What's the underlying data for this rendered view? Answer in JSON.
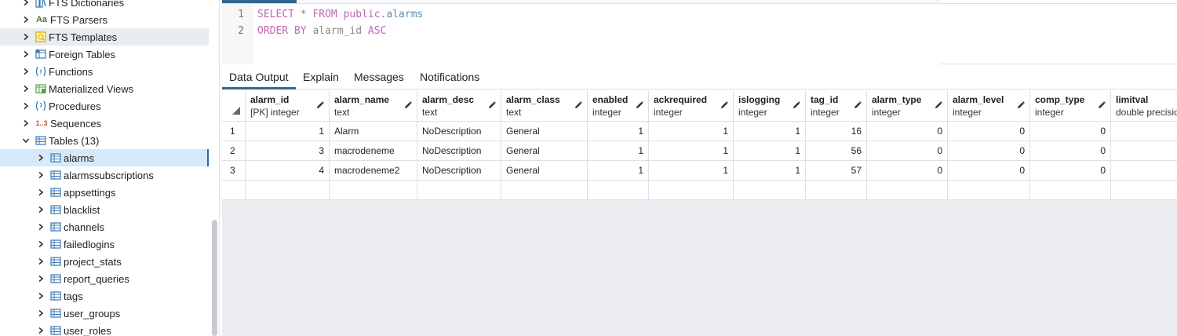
{
  "sidebar": {
    "items": [
      {
        "label": "FTS Dictionaries",
        "icon": "fts-dictionaries-icon",
        "level": 1,
        "state": "collapsed"
      },
      {
        "label": "FTS Parsers",
        "icon": "fts-parsers-icon",
        "glyph": "Aa",
        "level": 1,
        "state": "collapsed"
      },
      {
        "label": "FTS Templates",
        "icon": "fts-templates-icon",
        "level": 1,
        "state": "collapsed",
        "hover": true
      },
      {
        "label": "Foreign Tables",
        "icon": "foreign-tables-icon",
        "level": 1,
        "state": "collapsed"
      },
      {
        "label": "Functions",
        "icon": "functions-icon",
        "level": 1,
        "state": "collapsed"
      },
      {
        "label": "Materialized Views",
        "icon": "materialized-views-icon",
        "level": 1,
        "state": "collapsed"
      },
      {
        "label": "Procedures",
        "icon": "procedures-icon",
        "level": 1,
        "state": "collapsed"
      },
      {
        "label": "Sequences",
        "icon": "sequences-icon",
        "glyph": "1..3",
        "level": 1,
        "state": "collapsed"
      },
      {
        "label": "Tables (13)",
        "icon": "tables-icon",
        "level": 1,
        "state": "expanded"
      },
      {
        "label": "alarms",
        "icon": "table-icon",
        "level": 2,
        "state": "collapsed",
        "selected": true
      },
      {
        "label": "alarmssubscriptions",
        "icon": "table-icon",
        "level": 2,
        "state": "collapsed"
      },
      {
        "label": "appsettings",
        "icon": "table-icon",
        "level": 2,
        "state": "collapsed"
      },
      {
        "label": "blacklist",
        "icon": "table-icon",
        "level": 2,
        "state": "collapsed"
      },
      {
        "label": "channels",
        "icon": "table-icon",
        "level": 2,
        "state": "collapsed"
      },
      {
        "label": "failedlogins",
        "icon": "table-icon",
        "level": 2,
        "state": "collapsed"
      },
      {
        "label": "project_stats",
        "icon": "table-icon",
        "level": 2,
        "state": "collapsed"
      },
      {
        "label": "report_queries",
        "icon": "table-icon",
        "level": 2,
        "state": "collapsed"
      },
      {
        "label": "tags",
        "icon": "table-icon",
        "level": 2,
        "state": "collapsed"
      },
      {
        "label": "user_groups",
        "icon": "table-icon",
        "level": 2,
        "state": "collapsed"
      },
      {
        "label": "user_roles",
        "icon": "table-icon",
        "level": 2,
        "state": "collapsed"
      }
    ]
  },
  "editor": {
    "line_numbers": [
      "1",
      "2"
    ],
    "line1": {
      "kw1": "SELECT",
      "star": " * ",
      "kw2": "FROM",
      "schema": " public",
      "dot": ".",
      "table": "alarms"
    },
    "line2": {
      "kw1": "ORDER BY",
      "col": " alarm_id ",
      "kw2": "ASC"
    }
  },
  "tabs": [
    {
      "label": "Data Output",
      "active": true
    },
    {
      "label": "Explain",
      "active": false
    },
    {
      "label": "Messages",
      "active": false
    },
    {
      "label": "Notifications",
      "active": false
    }
  ],
  "grid": {
    "columns": [
      {
        "name": "alarm_id",
        "type": "[PK] integer",
        "align": "num"
      },
      {
        "name": "alarm_name",
        "type": "text",
        "align": "text"
      },
      {
        "name": "alarm_desc",
        "type": "text",
        "align": "text"
      },
      {
        "name": "alarm_class",
        "type": "text",
        "align": "text"
      },
      {
        "name": "enabled",
        "type": "integer",
        "align": "num"
      },
      {
        "name": "ackrequired",
        "type": "integer",
        "align": "num"
      },
      {
        "name": "islogging",
        "type": "integer",
        "align": "num"
      },
      {
        "name": "tag_id",
        "type": "integer",
        "align": "num"
      },
      {
        "name": "alarm_type",
        "type": "integer",
        "align": "num"
      },
      {
        "name": "alarm_level",
        "type": "integer",
        "align": "num"
      },
      {
        "name": "comp_type",
        "type": "integer",
        "align": "num"
      },
      {
        "name": "limitval",
        "type": "double precision",
        "align": "num"
      }
    ],
    "rows": [
      {
        "num": "1",
        "cells": [
          "1",
          "Alarm",
          "NoDescription",
          "General",
          "1",
          "1",
          "1",
          "16",
          "0",
          "0",
          "0",
          ""
        ]
      },
      {
        "num": "2",
        "cells": [
          "3",
          "macrodeneme",
          "NoDescription",
          "General",
          "1",
          "1",
          "1",
          "56",
          "0",
          "0",
          "0",
          ""
        ]
      },
      {
        "num": "3",
        "cells": [
          "4",
          "macrodeneme2",
          "NoDescription",
          "General",
          "1",
          "1",
          "1",
          "57",
          "0",
          "0",
          "0",
          ""
        ]
      },
      {
        "num": "",
        "cells": [
          "",
          "",
          "",
          "",
          "",
          "",
          "",
          "",
          "",
          "",
          "",
          ""
        ]
      }
    ]
  },
  "colors": {
    "accent": "#326690",
    "selected_row": "#d6e9f9",
    "keyword": "#c066b6",
    "identifier": "#5a8fb5"
  }
}
